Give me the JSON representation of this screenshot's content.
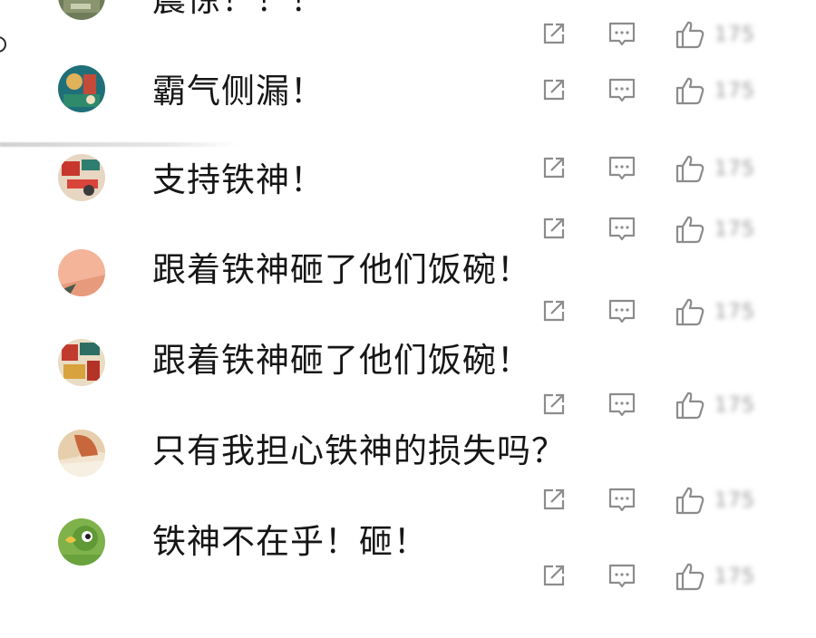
{
  "comments": [
    {
      "text": "震惊！！！",
      "avatar_icon": "user-avatar-icon",
      "like_count": "175"
    },
    {
      "text": "霸气侧漏！",
      "avatar_icon": "user-avatar-icon",
      "like_count": "175"
    },
    {
      "text": "支持铁神！",
      "avatar_icon": "user-avatar-icon",
      "like_count": "175"
    },
    {
      "text": "跟着铁神砸了他们饭碗！",
      "avatar_icon": "user-avatar-icon",
      "like_count": "175"
    },
    {
      "text": "跟着铁神砸了他们饭碗！",
      "avatar_icon": "user-avatar-icon",
      "like_count": "175"
    },
    {
      "text": "只有我担心铁神的损失吗？",
      "avatar_icon": "user-avatar-icon",
      "like_count": "175"
    },
    {
      "text": "铁神不在乎！砸！",
      "avatar_icon": "user-avatar-icon",
      "like_count": "175"
    }
  ],
  "extra_action_row_like_count": "175",
  "icons": {
    "share": "share-icon",
    "reply": "reply-icon",
    "like": "thumbs-up-icon"
  },
  "colors": {
    "icon_gray": "#8c8c8c",
    "text": "#161616",
    "divider": "#d2d2d2"
  }
}
